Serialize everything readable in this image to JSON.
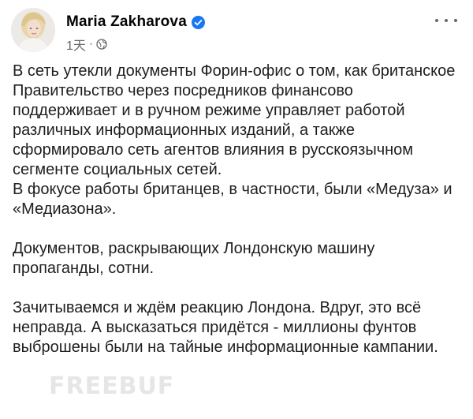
{
  "post": {
    "author": "Maria Zakharova",
    "verified_icon": "verified-badge-icon",
    "time": "1天",
    "separator": "·",
    "audience_icon": "globe-icon",
    "more_icon": "more-options-icon",
    "paragraphs": [
      "В сеть утекли документы Форин-офис о том, как британское Правительство  через посредников финансово поддерживает и в ручном режиме управляет работой различных информационных изданий, а также сформировало сеть агентов влияния в русскоязычном сегменте социальных сетей.\nВ фокусе работы британцев, в частности,  были «Медуза» и «Медиазона».",
      "Документов, раскрывающих Лондонскую машину пропаганды, сотни.",
      "Зачитываемся и ждём реакцию Лондона. Вдруг, это всё неправда. А высказаться придётся - миллионы фунтов выброшены были на тайные  информационные кампании."
    ]
  },
  "watermark": "FREEBUF",
  "colors": {
    "verified": "#1877f2",
    "meta_text": "#65676b",
    "body_text": "#1c1e21"
  }
}
